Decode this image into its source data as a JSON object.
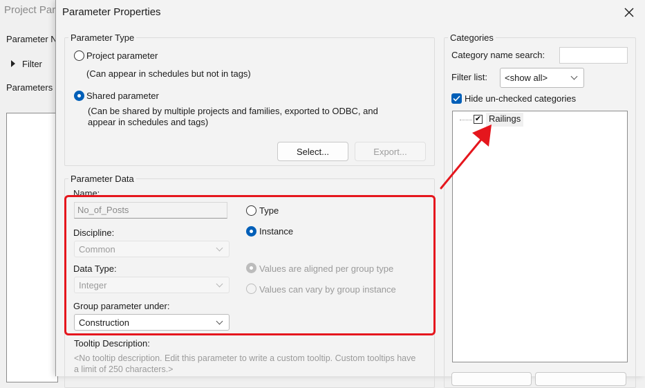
{
  "background_window": {
    "title": "Project Para",
    "parameter_name_label": "Parameter N",
    "filter_label": "Filter",
    "parameters_label": "Parameters"
  },
  "dialog": {
    "title": "Parameter Properties",
    "close_icon": "close-icon"
  },
  "parameter_type": {
    "legend": "Parameter Type",
    "project_label": "Project parameter",
    "project_desc": "(Can appear in schedules but not in tags)",
    "shared_label": "Shared parameter",
    "shared_desc_1": "(Can be shared by multiple projects and families, exported to ODBC, and",
    "shared_desc_2": "appear in schedules and tags)",
    "select_button": "Select...",
    "export_button": "Export...",
    "selected": "shared"
  },
  "parameter_data": {
    "legend": "Parameter Data",
    "name_label": "Name:",
    "name_value": "No_of_Posts",
    "discipline_label": "Discipline:",
    "discipline_value": "Common",
    "data_type_label": "Data Type:",
    "data_type_value": "Integer",
    "group_label": "Group parameter under:",
    "group_value": "Construction",
    "type_label": "Type",
    "instance_label": "Instance",
    "instance_selected": true,
    "aligned_label": "Values are aligned per group type",
    "vary_label": "Values can vary by group instance",
    "tooltip_label": "Tooltip Description:",
    "tooltip_text_1": "<No tooltip description. Edit this parameter to write a custom tooltip. Custom tooltips have",
    "tooltip_text_2": "a limit of 250 characters.>"
  },
  "categories": {
    "legend": "Categories",
    "search_label": "Category name search:",
    "search_value": "",
    "filter_label": "Filter list:",
    "filter_value": "<show all>",
    "hide_unchecked_label": "Hide un-checked categories",
    "hide_unchecked_checked": true,
    "items": [
      {
        "label": "Railings",
        "checked": true
      }
    ]
  },
  "annotations": {
    "highlight_color": "#e5161d",
    "arrow_color": "#e5161d"
  }
}
